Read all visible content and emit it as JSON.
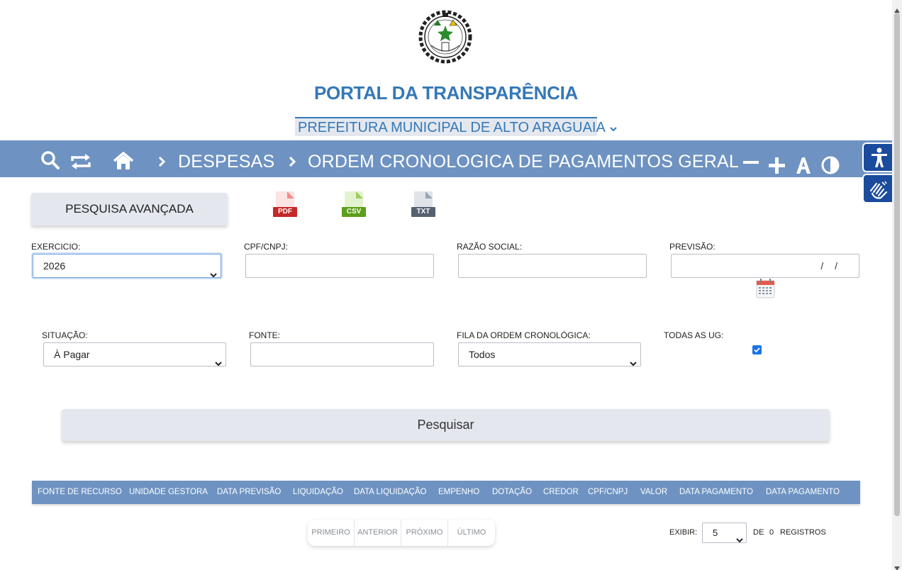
{
  "header": {
    "logo_icon": "municipal-coat-of-arms",
    "portal_title": "PORTAL DA TRANSPARÊNCIA",
    "entity_select": "PREFEITURA MUNICIPAL DE ALTO ARAGUAIA"
  },
  "nav": {
    "icons": [
      "search-icon",
      "refresh-icon",
      "home-icon"
    ],
    "breadcrumb": [
      "DESPESAS",
      "ORDEM CRONOLOGICA DE PAGAMENTOS GERAL"
    ],
    "controls": [
      "decrease-font-icon",
      "increase-font-icon",
      "font-icon",
      "contrast-icon"
    ]
  },
  "accessibility": [
    "accessibility-icon",
    "sign-language-icon"
  ],
  "toolbar": {
    "advanced_search_label": "PESQUISA AVANÇADA",
    "exports": [
      {
        "label": "PDF",
        "color": "#c62828"
      },
      {
        "label": "CSV",
        "color": "#5c9f1a"
      },
      {
        "label": "TXT",
        "color": "#546170"
      }
    ]
  },
  "filters": {
    "exercicio": {
      "label": "EXERCICIO:",
      "value": "2026"
    },
    "cpf_cnpj": {
      "label": "CPF/CNPJ:",
      "value": ""
    },
    "razao_social": {
      "label": "RAZÃO SOCIAL:",
      "value": ""
    },
    "previsao": {
      "label": "PREVISÃO:",
      "value": "/ /"
    },
    "situacao": {
      "label": "SITUAÇÃO:",
      "value": "À Pagar"
    },
    "fonte": {
      "label": "FONTE:",
      "value": ""
    },
    "fila": {
      "label": "FILA DA ORDEM CRONOLÓGICA:",
      "value": "Todos"
    },
    "todas_ug": {
      "label": "TODAS AS UG:",
      "checked": true
    }
  },
  "search_button": "Pesquisar",
  "table": {
    "columns": [
      "FONTE DE RECURSO",
      "UNIDADE GESTORA",
      "DATA PREVISÃO",
      "LIQUIDAÇÃO",
      "DATA LIQUIDAÇÃO",
      "EMPENHO",
      "DOTAÇÃO",
      "CREDOR",
      "CPF/CNPJ",
      "VALOR",
      "DATA PAGAMENTO",
      "DATA PAGAMENTO"
    ],
    "rows": []
  },
  "pagination": {
    "buttons": [
      "PRIMEIRO",
      "ANTERIOR",
      "PRÓXIMO",
      "ÚLTIMO"
    ],
    "exibir_label": "EXIBIR:",
    "exibir_value": "5",
    "de_label": "DE",
    "total": "0",
    "registros_label": "REGISTROS"
  },
  "colors": {
    "nav_bar": "#6e93c2",
    "title_blue": "#3478b7",
    "button_bg": "#e4e8ee",
    "a11y_blue": "#1a4b9c"
  }
}
